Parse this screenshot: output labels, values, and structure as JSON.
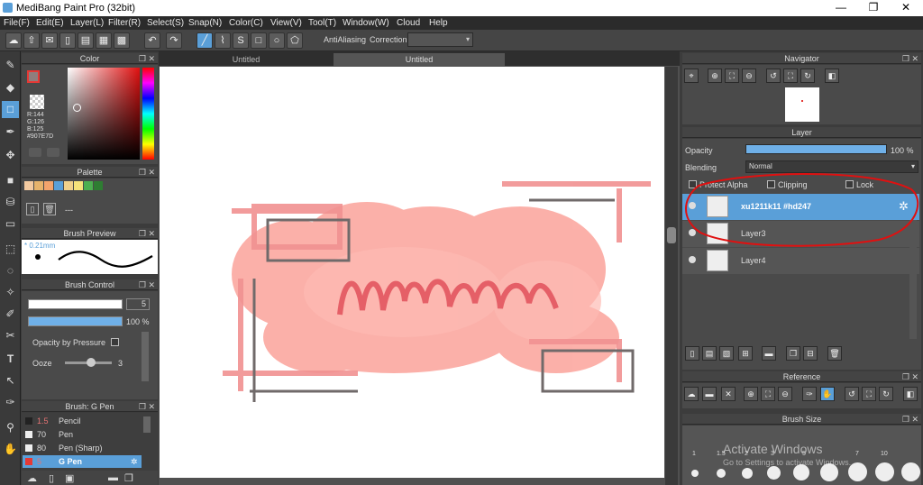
{
  "app": {
    "title": "MediBang Paint Pro (32bit)",
    "min": "—",
    "max": "❐",
    "close": "✕"
  },
  "menu": [
    "File(F)",
    "Edit(E)",
    "Layer(L)",
    "Filter(R)",
    "Select(S)",
    "Snap(N)",
    "Color(C)",
    "View(V)",
    "Tool(T)",
    "Window(W)",
    "Cloud",
    "Help"
  ],
  "toolbar": {
    "antialias": "AntiAliasing",
    "correction": "Correction",
    "undo": "↶",
    "redo": "↷"
  },
  "color": {
    "title": "Color",
    "r": "R:144",
    "g": "G:126",
    "b": "B:125",
    "hex": "#907E7D",
    "accent": "#907E7D"
  },
  "palette": {
    "title": "Palette",
    "swatches": [
      "#f2c9a0",
      "#e6b36c",
      "#f4a46c",
      "#5a9fd8",
      "#f0d08a",
      "#f6e27a",
      "#4caf50",
      "#2e7d32"
    ],
    "more": "---"
  },
  "brush_preview": {
    "title": "Brush Preview",
    "size": "* 0.21mm"
  },
  "brush_control": {
    "title": "Brush Control",
    "size_value": "5",
    "opacity_value": "100 %",
    "opacity_fill": 1.0,
    "opacity_pressure": "Opacity by Pressure",
    "ooze": "Ooze",
    "ooze_value": "3"
  },
  "brush_list": {
    "title": "Brush: G Pen",
    "items": [
      {
        "size": "1.5",
        "name": "Pencil",
        "color": "#222"
      },
      {
        "size": "70",
        "name": "Pen",
        "color": "#eee"
      },
      {
        "size": "80",
        "name": "Pen (Sharp)",
        "color": "#eee"
      },
      {
        "size": "5",
        "name": "G Pen",
        "color": "#e53935"
      }
    ]
  },
  "tabs": [
    "Untitled",
    "Untitled"
  ],
  "navigator": {
    "title": "Navigator"
  },
  "layer": {
    "title": "Layer",
    "opacity_label": "Opacity",
    "opacity_value": "100 %",
    "opacity_fill": 1.0,
    "blending_label": "Blending",
    "blending_value": "Normal",
    "protect_alpha": "Protect Alpha",
    "clipping": "Clipping",
    "lock": "Lock",
    "layers": [
      {
        "name": "xu1211k11 #hd247"
      },
      {
        "name": "Layer3"
      },
      {
        "name": "Layer4"
      }
    ]
  },
  "reference": {
    "title": "Reference"
  },
  "brush_size": {
    "title": "Brush Size",
    "labels": [
      "1",
      "1.5",
      "2",
      "3",
      "5",
      "7",
      "10"
    ]
  },
  "watermark": {
    "line1": "Activate Windows",
    "line2": "Go to Settings to activate Windows."
  }
}
